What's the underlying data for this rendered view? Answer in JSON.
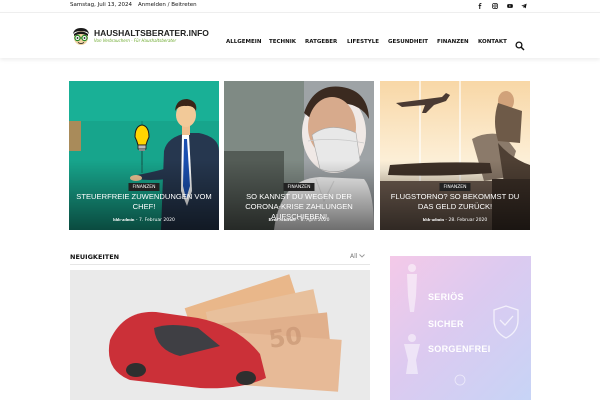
{
  "topbar": {
    "date": "Samstag, Juli 13, 2024",
    "login": "Anmelden / Beitreten",
    "social_icons": [
      "facebook-icon",
      "instagram-icon",
      "youtube-icon",
      "telegram-icon"
    ]
  },
  "logo": {
    "title": "HAUSHALTSBERATER.INFO",
    "subtitle": "Von Verbrauchern - Für Haushaltsberater"
  },
  "nav": {
    "items": [
      "ALLGEMEIN",
      "TECHNIK",
      "RATGEBER",
      "LIFESTYLE",
      "GESUNDHEIT",
      "FINANZEN",
      "KONTAKT"
    ],
    "search_icon": "search-icon"
  },
  "featured": [
    {
      "category": "FINANZEN",
      "title": "Steuerfreie Zuwendungen vom Chef!",
      "author": "hhb-admin",
      "date": "7. Februar 2020"
    },
    {
      "category": "FINANZEN",
      "title": "So kannst du wegen der Corona-Krise Zahlungen aufschieben!",
      "author": "René Schirner",
      "date": "8. April 2020"
    },
    {
      "category": "FINANZEN",
      "title": "Flugstorno? So bekommst du das Geld zurück!",
      "author": "hhb-admin",
      "date": "28. Februar 2020"
    }
  ],
  "news": {
    "title": "NEUIGKEITEN",
    "filter": "All"
  },
  "ad": {
    "words": [
      "SERIÖS",
      "SICHER",
      "SORGENFREI"
    ]
  },
  "colors": {
    "accent": "#6aa82a",
    "category_bg": "#222222",
    "ad_pink": "#f4c9e8",
    "ad_blue": "#c7d4f6"
  }
}
